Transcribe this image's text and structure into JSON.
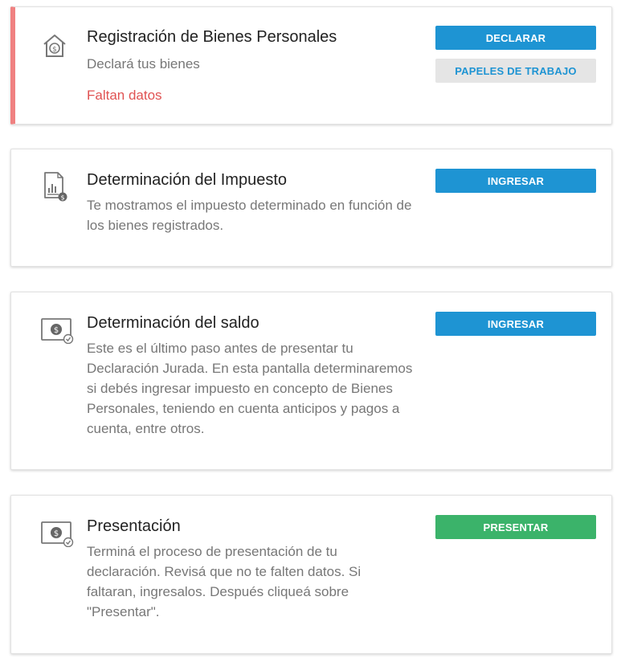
{
  "colors": {
    "primary": "#1e94d3",
    "success": "#3bb36a",
    "alert_border": "#f08181",
    "alert_text": "#e05252"
  },
  "cards": [
    {
      "icon": "house-dollar-icon",
      "title": "Registración de Bienes Personales",
      "description": "Declará tus bienes",
      "status": "Faltan datos",
      "buttons": [
        {
          "label": "DECLARAR",
          "style": "primary"
        },
        {
          "label": "PAPELES DE TRABAJO",
          "style": "secondary"
        }
      ]
    },
    {
      "icon": "report-chart-dollar-icon",
      "title": "Determinación del Impuesto",
      "description": "Te mostramos el impuesto determinado en función de los bienes registrados.",
      "buttons": [
        {
          "label": "INGRESAR",
          "style": "primary"
        }
      ]
    },
    {
      "icon": "dollar-monitor-check-icon",
      "title": "Determinación del saldo",
      "description": "Este es el último paso antes de presentar tu Declaración Jurada. En esta pantalla determinaremos si debés ingresar impuesto en concepto de Bienes Personales, teniendo en cuenta anticipos y pagos a cuenta, entre otros.",
      "buttons": [
        {
          "label": "INGRESAR",
          "style": "primary"
        }
      ]
    },
    {
      "icon": "dollar-monitor-check-icon",
      "title": "Presentación",
      "description": "Terminá el proceso de presentación de tu declaración. Revisá que no te falten datos. Si faltaran, ingresalos. Después cliqueá sobre \"Presentar\".",
      "buttons": [
        {
          "label": "PRESENTAR",
          "style": "success"
        }
      ]
    }
  ]
}
